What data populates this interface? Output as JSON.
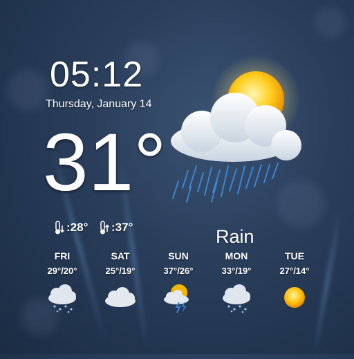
{
  "clock": {
    "time": "05:12",
    "date": "Thursday, January 14"
  },
  "current": {
    "temperature": "31°",
    "low": ":28°",
    "high": ":37°",
    "condition": "Rain",
    "icon": "sun-cloud-rain-icon"
  },
  "forecast": [
    {
      "day": "FRI",
      "range": "29°/20°",
      "icon": "cloud-snow-icon"
    },
    {
      "day": "SAT",
      "range": "25°/19°",
      "icon": "cloud-icon"
    },
    {
      "day": "SUN",
      "range": "37°/26°",
      "icon": "sun-cloud-thunder-icon"
    },
    {
      "day": "MON",
      "range": "33°/19°",
      "icon": "cloud-snow-icon"
    },
    {
      "day": "TUE",
      "range": "27°/14°",
      "icon": "sun-icon"
    }
  ],
  "colors": {
    "sun": "#f5b400",
    "rain": "#3a86d8",
    "background": "#2a3f5c"
  }
}
